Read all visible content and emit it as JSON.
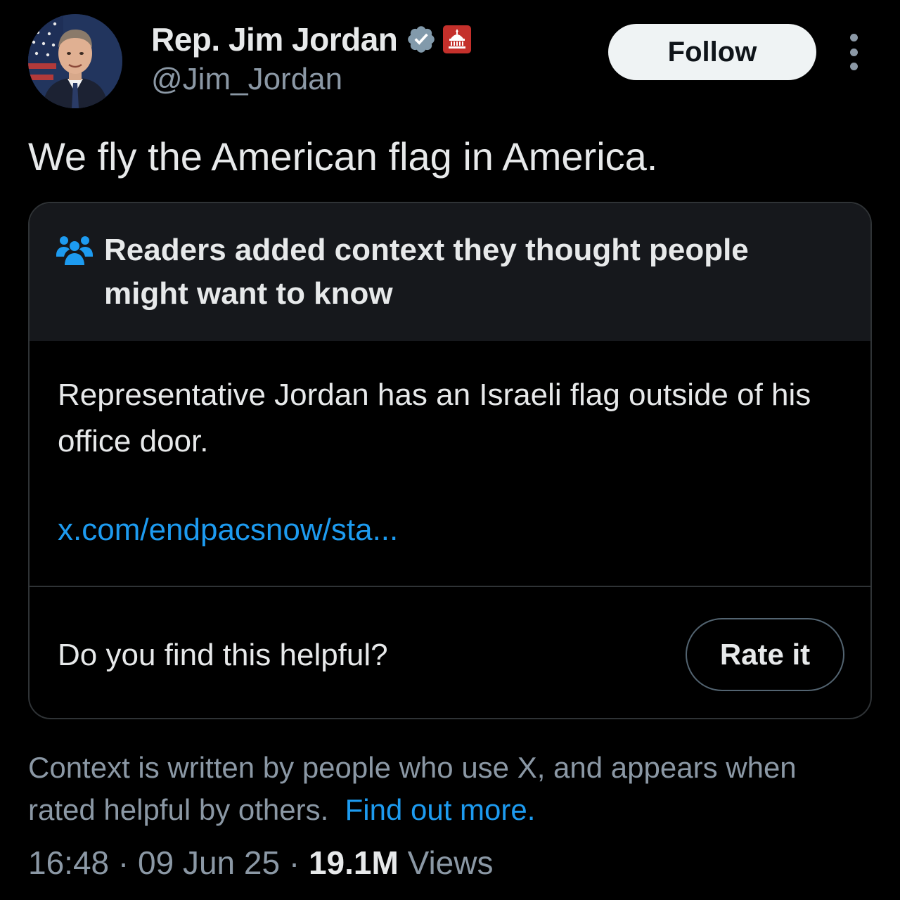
{
  "author": {
    "display_name": "Rep. Jim Jordan",
    "handle": "@Jim_Jordan",
    "avatar_icon": "profile-photo",
    "verified_icon": "verified-badge-icon",
    "affiliation_icon": "us-government-badge-icon"
  },
  "actions": {
    "follow_label": "Follow",
    "more_icon": "more-options-icon"
  },
  "tweet": {
    "text": "We fly the American flag in America."
  },
  "community_note": {
    "icon": "people-icon",
    "title": "Readers added context they thought people might want to know",
    "body": "Representative Jordan has an Israeli flag outside of his office door.",
    "link_text": "x.com/endpacsnow/sta...",
    "helpful_question": "Do you find this helpful?",
    "rate_label": "Rate it"
  },
  "context_info": {
    "text": "Context is written by people who use X, and appears when rated helpful by others.",
    "link_text": "Find out more."
  },
  "meta": {
    "time": "16:48",
    "separator": " · ",
    "date": "09 Jun 25",
    "views_count": "19.1M",
    "views_label": " Views"
  },
  "colors": {
    "background": "#000000",
    "accent_link": "#1d9bf0",
    "secondary_text": "#8b98a5",
    "primary_text": "#e7e9ea",
    "note_header_bg": "#16181c",
    "verified_badge": "#829aab",
    "gov_badge": "#c4302b"
  }
}
